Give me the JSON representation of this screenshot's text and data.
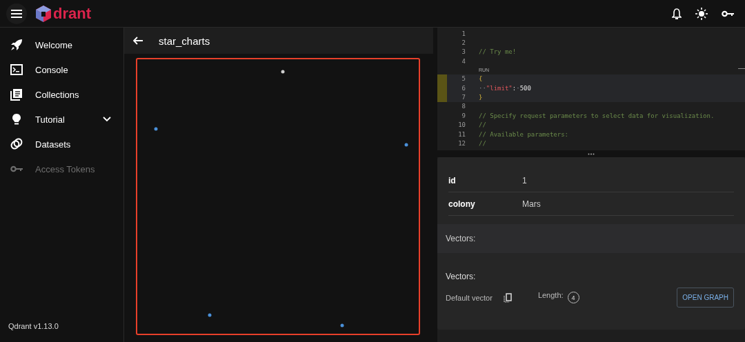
{
  "topbar": {
    "logo_text": "drant"
  },
  "sidebar": {
    "items": [
      {
        "label": "Welcome",
        "disabled": false
      },
      {
        "label": "Console",
        "disabled": false
      },
      {
        "label": "Collections",
        "disabled": false
      },
      {
        "label": "Tutorial",
        "disabled": false,
        "expanded": false
      },
      {
        "label": "Datasets",
        "disabled": false
      },
      {
        "label": "Access Tokens",
        "disabled": true
      }
    ],
    "version": "Qdrant v1.13.0"
  },
  "collection": {
    "title": "star_charts"
  },
  "editor": {
    "run_label": "RUN",
    "lines": [
      {
        "number": "1",
        "highlighted": false
      },
      {
        "number": "2",
        "highlighted": false
      },
      {
        "number": "3",
        "highlighted": false,
        "tokens": [
          {
            "text": "// Try me!",
            "kind": "comment"
          }
        ]
      },
      {
        "number": "4",
        "highlighted": false
      },
      {
        "number": "5",
        "highlighted": true,
        "tokens": [
          {
            "text": "{",
            "kind": "brace"
          }
        ]
      },
      {
        "number": "6",
        "highlighted": true,
        "tokens": [
          {
            "text": "··",
            "kind": "whitespace"
          },
          {
            "text": "\"limit\"",
            "kind": "key"
          },
          {
            "text": ":",
            "kind": "plain"
          },
          {
            "text": "·",
            "kind": "whitespace"
          },
          {
            "text": "500",
            "kind": "plain"
          }
        ]
      },
      {
        "number": "7",
        "highlighted": true,
        "tokens": [
          {
            "text": "}",
            "kind": "brace"
          }
        ]
      },
      {
        "number": "8",
        "highlighted": false
      },
      {
        "number": "9",
        "highlighted": false,
        "tokens": [
          {
            "text": "// Specify request parameters to select data for visualization.",
            "kind": "comment"
          }
        ]
      },
      {
        "number": "10",
        "highlighted": false,
        "tokens": [
          {
            "text": "//",
            "kind": "comment"
          }
        ]
      },
      {
        "number": "11",
        "highlighted": false,
        "tokens": [
          {
            "text": "// Available parameters:",
            "kind": "comment"
          }
        ]
      },
      {
        "number": "12",
        "highlighted": false,
        "tokens": [
          {
            "text": "//",
            "kind": "comment"
          }
        ]
      }
    ]
  },
  "point": {
    "fields": [
      {
        "key": "id",
        "value": "1"
      },
      {
        "key": "colony",
        "value": "Mars"
      }
    ],
    "vectors_heading": "Vectors:",
    "vectors_label": "Vectors:",
    "vector": {
      "name": "Default vector",
      "length_label": "Length:",
      "length": "4"
    },
    "open_graph_button": "OPEN GRAPH"
  }
}
